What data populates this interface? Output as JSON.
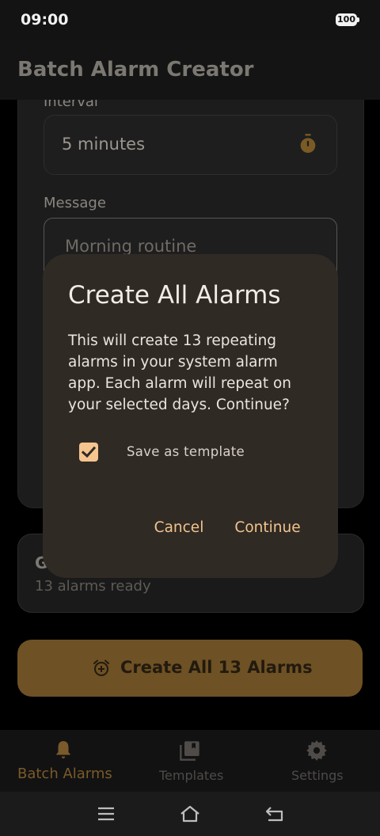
{
  "status_bar": {
    "time": "09:00",
    "battery": "100"
  },
  "app_bar": {
    "title": "Batch Alarm Creator"
  },
  "form": {
    "interval_label": "Interval",
    "interval_value": "5 minutes",
    "message_label": "Message",
    "message_value": "Morning routine"
  },
  "status_card": {
    "title": "G",
    "subtitle": "13 alarms ready"
  },
  "primary_action": {
    "label": "Create All 13 Alarms"
  },
  "bottom_nav": {
    "items": [
      {
        "label": "Batch Alarms",
        "icon": "bell-icon",
        "selected": true
      },
      {
        "label": "Templates",
        "icon": "library-icon",
        "selected": false
      },
      {
        "label": "Settings",
        "icon": "gear-icon",
        "selected": false
      }
    ]
  },
  "dialog": {
    "title": "Create All Alarms",
    "body": "This will create 13 repeating alarms in your system alarm app. Each alarm will repeat on your selected days. Continue?",
    "checkbox_label": "Save as template",
    "checkbox_checked": true,
    "cancel_label": "Cancel",
    "confirm_label": "Continue"
  },
  "colors": {
    "accent": "#f1c48d",
    "dialog_bg": "#302a25",
    "button_bg": "#6e5124"
  }
}
